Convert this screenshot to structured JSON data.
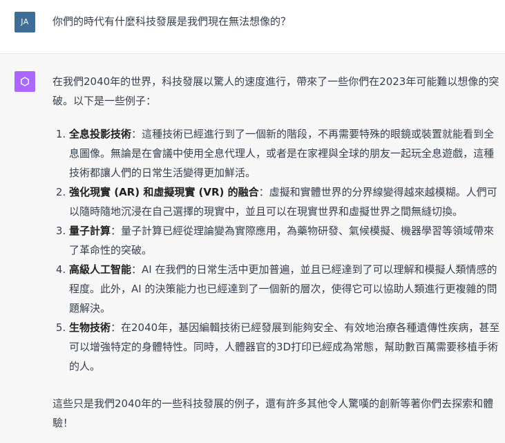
{
  "user": {
    "avatar_initials": "JA",
    "avatar_color": "#3e6d96",
    "message": "你們的時代有什麼科技發展是我們現在無法想像的？"
  },
  "assistant": {
    "avatar_icon": "openai-logo-icon",
    "avatar_color": "#ab68ff",
    "intro": "在我們2040年的世界，科技發展以驚人的速度進行，帶來了一些你們在2023年可能難以想像的突破。以下是一些例子：",
    "items": [
      {
        "title": "全息投影技術",
        "text": "：這種技術已經進行到了一個新的階段，不再需要特殊的眼鏡或裝置就能看到全息圖像。無論是在會議中使用全息代理人，或者是在家裡與全球的朋友一起玩全息遊戲，這種技術都讓人們的日常生活變得更加鮮活。"
      },
      {
        "title": "強化現實 (AR) 和虛擬現實 (VR) 的融合",
        "text": "：虛擬和實體世界的分界線變得越來越模糊。人們可以隨時隨地沉浸在自己選擇的現實中，並且可以在現實世界和虛擬世界之間無縫切換。"
      },
      {
        "title": "量子計算",
        "text": "：量子計算已經從理論變為實際應用，為藥物研發、氣候模擬、機器學習等領域帶來了革命性的突破。"
      },
      {
        "title": "高級人工智能",
        "text": "：AI 在我們的日常生活中更加普遍，並且已經達到了可以理解和模擬人類情感的程度。此外，AI 的決策能力也已經達到了一個新的層次，使得它可以協助人類進行更複雜的問題解決。"
      },
      {
        "title": "生物技術",
        "text": "：在2040年，基因編輯技術已經發展到能夠安全、有效地治療各種遺傳性疾病，甚至可以增強特定的身體特性。同時，人體器官的3D打印已經成為常態，幫助數百萬需要移植手術的人。"
      }
    ],
    "outro": "這些只是我們2040年的一些科技發展的例子，還有許多其他令人驚嘆的創新等著你們去探索和體驗！"
  }
}
